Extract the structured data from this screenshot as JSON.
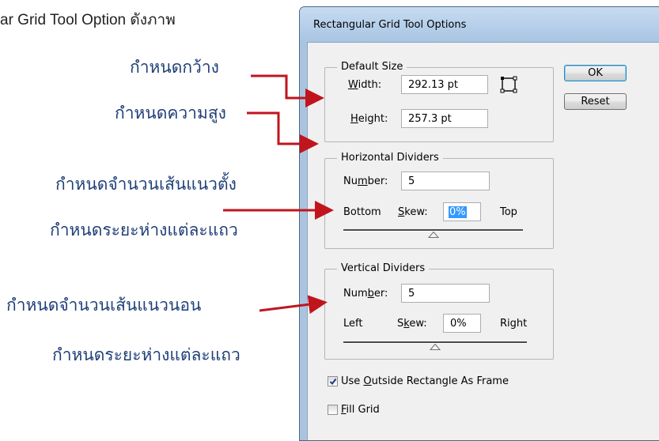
{
  "caption": "ar Grid Tool Option ดังภาพ",
  "annotations": {
    "width": "กำหนดกว้าง",
    "height": "กำหนดความสูง",
    "horizontal_count": "กำหนดจำนวนเส้นแนวตั้ง",
    "horizontal_spacing": "กำหนดระยะห่างแต่ละแถว",
    "vertical_count": "กำหนดจำนวนเส้นแนวนอน",
    "vertical_spacing": "กำหนดระยะห่างแต่ละแถว"
  },
  "colors": {
    "arrow": "#c0151d",
    "annotation_text": "#1f3f78",
    "selection": "#3399ff"
  },
  "dialog": {
    "title": "Rectangular Grid Tool Options",
    "ok_label": "OK",
    "reset_label": "Reset",
    "default_size": {
      "legend": "Default Size",
      "width_label_mn": "W",
      "width_label_rest": "idth:",
      "width_value": "292.13 pt",
      "height_label_mn": "H",
      "height_label_rest": "eight:",
      "height_value": "257.3 pt",
      "icon": "rectangle-origin-icon"
    },
    "horizontal": {
      "legend": "Horizontal Dividers",
      "number_label_a": "Nu",
      "number_label_mn": "m",
      "number_label_b": "ber:",
      "number_value": "5",
      "left_label": "Bottom",
      "skew_label_mn": "S",
      "skew_label_rest": "kew:",
      "skew_value": "0%",
      "right_label": "Top",
      "skew_fraction": 0.5
    },
    "vertical": {
      "legend": "Vertical Dividers",
      "number_label_a": "Num",
      "number_label_mn": "b",
      "number_label_b": "er:",
      "number_value": "5",
      "left_label": "Left",
      "skew_label_a": "S",
      "skew_label_mn": "k",
      "skew_label_b": "ew:",
      "skew_value": "0%",
      "right_label": "Right",
      "skew_fraction": 0.5
    },
    "use_outside": {
      "label_a": "Use ",
      "label_mn": "O",
      "label_b": "utside Rectangle As Frame",
      "checked": true
    },
    "fill_grid": {
      "label_mn": "F",
      "label_b": "ill Grid",
      "checked": false
    }
  }
}
